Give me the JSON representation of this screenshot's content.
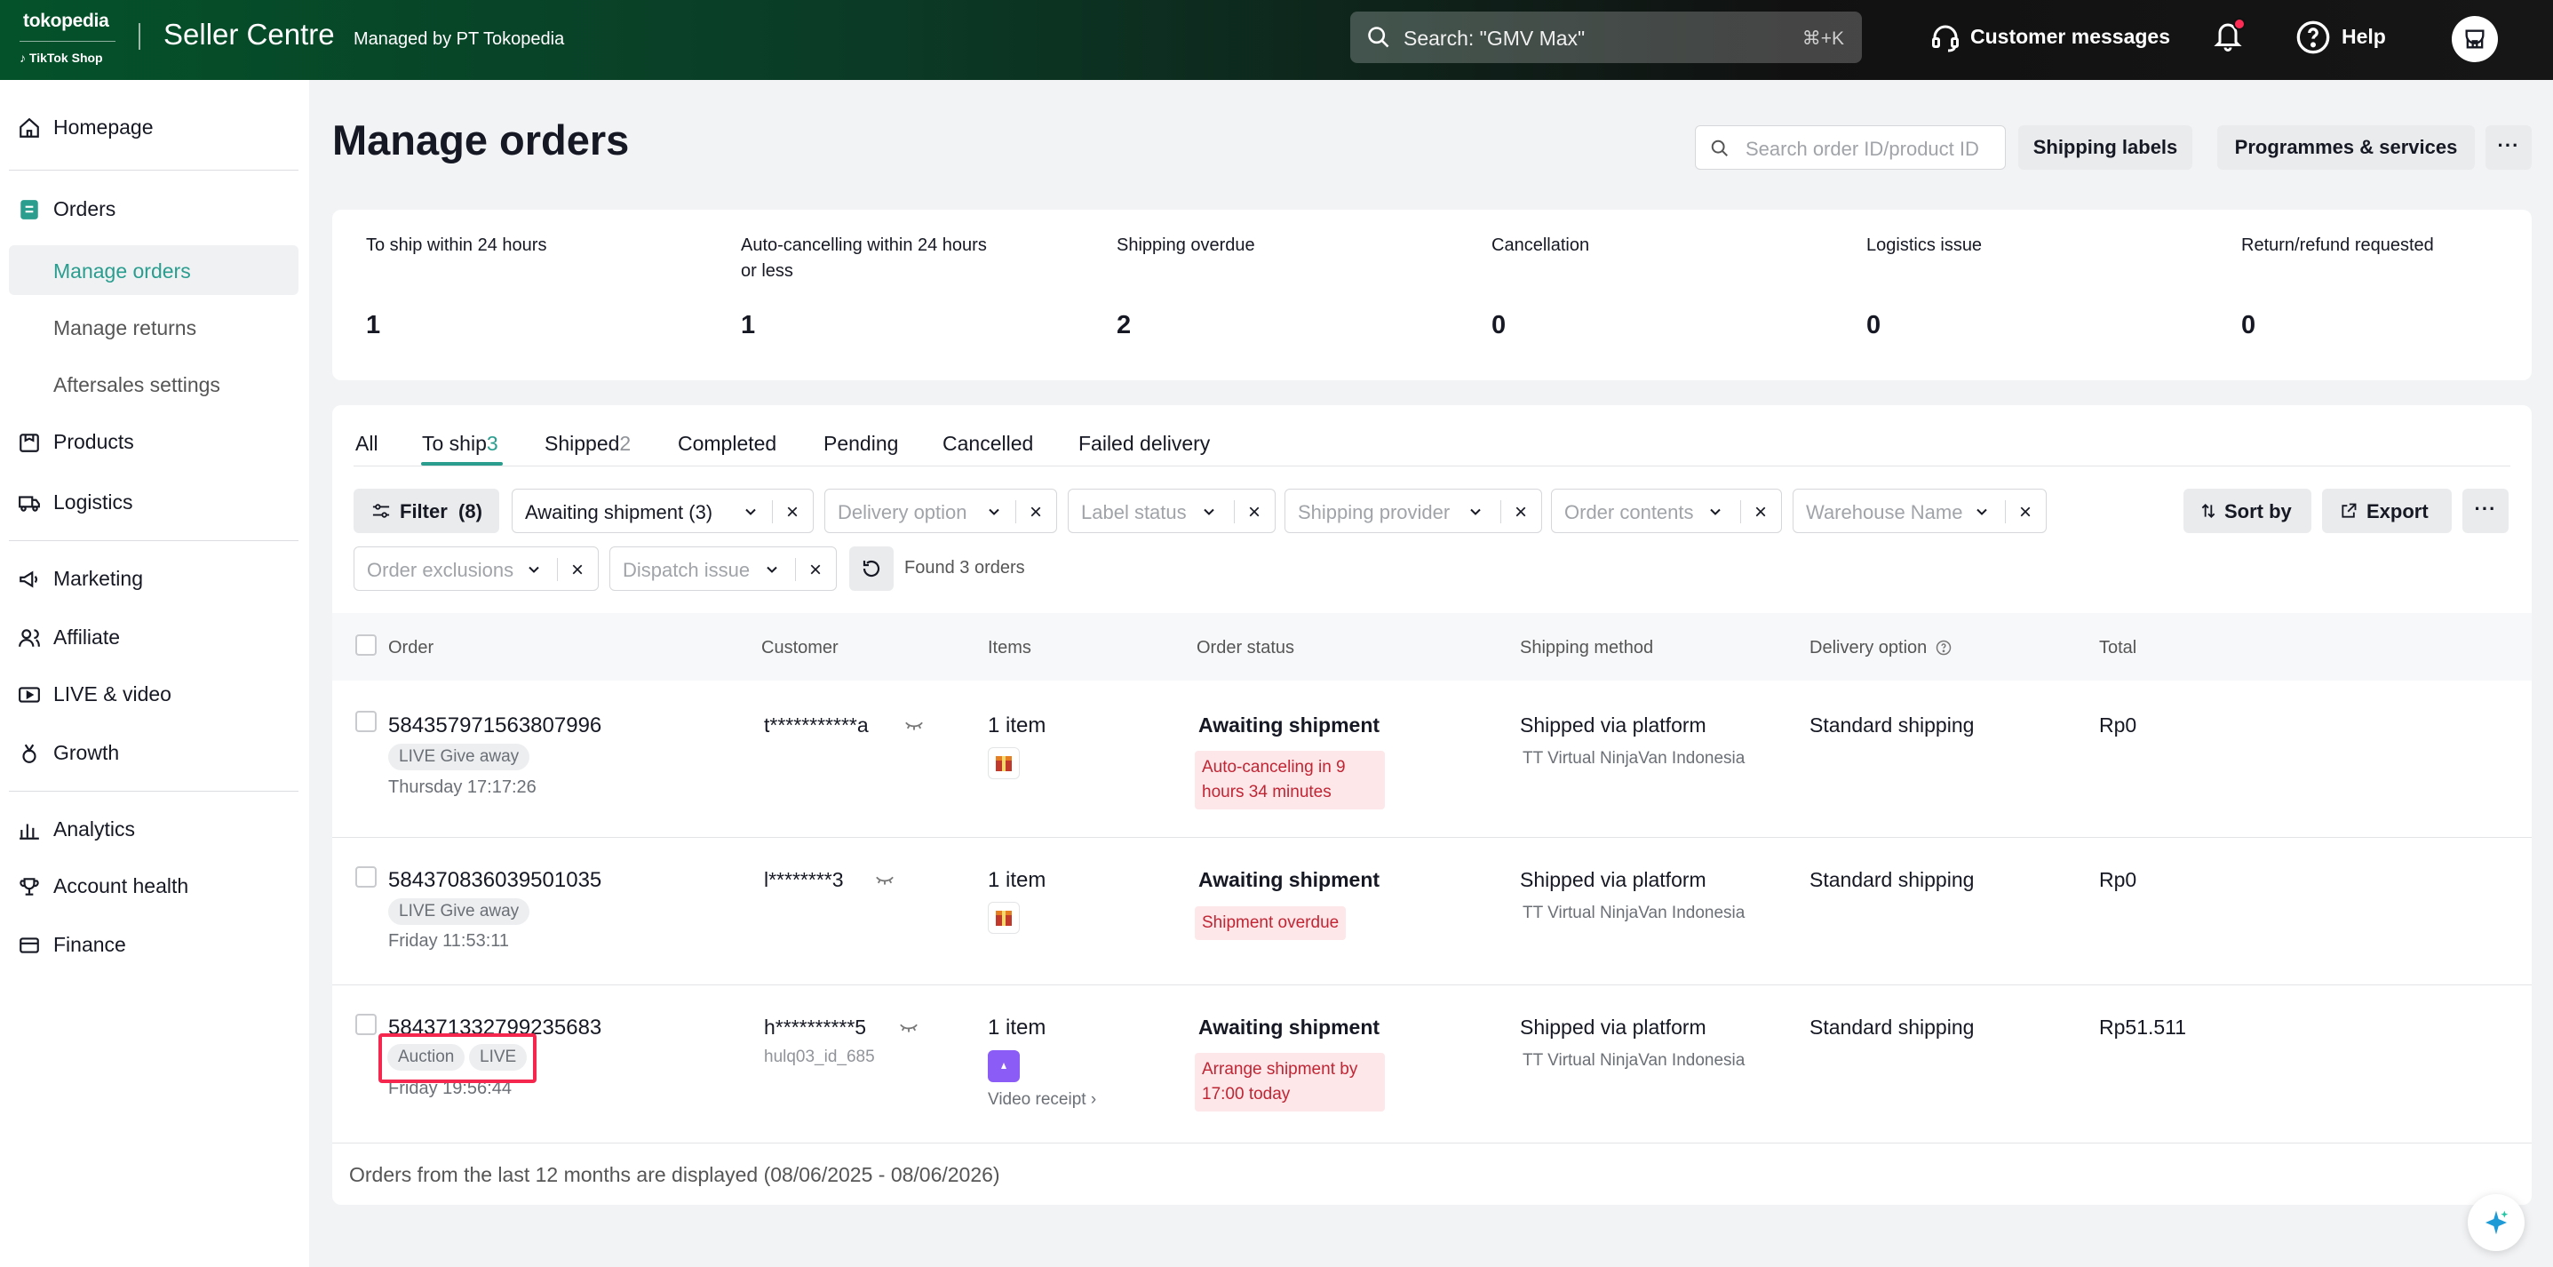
{
  "topbar": {
    "brand_top": "tokopedia",
    "brand_bottom": "TikTok Shop",
    "title": "Seller Centre",
    "managed_by": "Managed by PT Tokopedia",
    "search_placeholder": "Search: \"GMV Max\"",
    "search_shortcut": "⌘+K",
    "customer_messages": "Customer messages",
    "help": "Help"
  },
  "sidebar": {
    "items": [
      {
        "label": "Homepage",
        "icon": "home-icon"
      },
      {
        "label": "Orders",
        "icon": "orders-icon"
      },
      {
        "label": "Manage orders",
        "active": true
      },
      {
        "label": "Manage returns"
      },
      {
        "label": "Aftersales settings"
      },
      {
        "label": "Products",
        "icon": "products-icon"
      },
      {
        "label": "Logistics",
        "icon": "truck-icon"
      },
      {
        "label": "Marketing",
        "icon": "megaphone-icon"
      },
      {
        "label": "Affiliate",
        "icon": "affiliate-icon"
      },
      {
        "label": "LIVE & video",
        "icon": "video-icon"
      },
      {
        "label": "Growth",
        "icon": "medal-icon"
      },
      {
        "label": "Analytics",
        "icon": "analytics-icon"
      },
      {
        "label": "Account health",
        "icon": "trophy-icon"
      },
      {
        "label": "Finance",
        "icon": "wallet-icon"
      }
    ]
  },
  "header": {
    "title": "Manage orders",
    "search_placeholder": "Search order ID/product ID",
    "shipping_labels": "Shipping labels",
    "programmes": "Programmes & services"
  },
  "stats": [
    {
      "label": "To ship within 24 hours",
      "value": "1"
    },
    {
      "label": "Auto-cancelling within 24 hours or less",
      "value": "1"
    },
    {
      "label": "Shipping overdue",
      "value": "2"
    },
    {
      "label": "Cancellation",
      "value": "0"
    },
    {
      "label": "Logistics issue",
      "value": "0"
    },
    {
      "label": "Return/refund requested",
      "value": "0"
    }
  ],
  "tabs": [
    {
      "label": "All",
      "count": ""
    },
    {
      "label": "To ship",
      "count": "3"
    },
    {
      "label": "Shipped",
      "count": "2"
    },
    {
      "label": "Completed",
      "count": ""
    },
    {
      "label": "Pending",
      "count": ""
    },
    {
      "label": "Cancelled",
      "count": ""
    },
    {
      "label": "Failed delivery",
      "count": ""
    }
  ],
  "filters": {
    "filter_label": "Filter",
    "filter_count": "(8)",
    "chips": [
      "Awaiting shipment (3)",
      "Delivery option",
      "Label status",
      "Shipping provider",
      "Order contents",
      "Warehouse Name",
      "Order exclusions",
      "Dispatch issue"
    ],
    "found": "Found 3 orders",
    "sort_by": "Sort by",
    "export": "Export"
  },
  "table": {
    "headers": {
      "order": "Order",
      "customer": "Customer",
      "items": "Items",
      "status": "Order status",
      "shipping": "Shipping method",
      "delivery": "Delivery option",
      "total": "Total"
    },
    "rows": [
      {
        "order_id": "584357971563807996",
        "tags": [
          "LIVE Give away"
        ],
        "time": "Thursday 17:17:26",
        "customer": "t***********a",
        "customer_sub": "",
        "items": "1 item",
        "video_receipt": "",
        "status": "Awaiting shipment",
        "warning": "Auto-canceling in 9 hours 34 minutes",
        "shipping": "Shipped via platform",
        "shipping_sub": "TT Virtual NinjaVan Indonesia",
        "delivery": "Standard shipping",
        "total": "Rp0"
      },
      {
        "order_id": "584370836039501035",
        "tags": [
          "LIVE Give away"
        ],
        "time": "Friday 11:53:11",
        "customer": "l********3",
        "customer_sub": "",
        "items": "1 item",
        "video_receipt": "",
        "status": "Awaiting shipment",
        "warning": "Shipment overdue",
        "shipping": "Shipped via platform",
        "shipping_sub": "TT Virtual NinjaVan Indonesia",
        "delivery": "Standard shipping",
        "total": "Rp0"
      },
      {
        "order_id": "584371332799235683",
        "tags": [
          "Auction",
          "LIVE"
        ],
        "time": "Friday 19:56:44",
        "customer": "h**********5",
        "customer_sub": "hulq03_id_685",
        "items": "1 item",
        "video_receipt": "Video receipt ›",
        "status": "Awaiting shipment",
        "warning": "Arrange shipment by 17:00 today",
        "shipping": "Shipped via platform",
        "shipping_sub": "TT Virtual NinjaVan Indonesia",
        "delivery": "Standard shipping",
        "total": "Rp51.511"
      }
    ]
  },
  "footer_note": "Orders from the last 12 months are displayed (08/06/2025 - 08/06/2026)",
  "colors": {
    "accent": "#2a9d8f",
    "warning_bg": "#fde7e9",
    "warning_text": "#c02534",
    "highlight": "#f5274e"
  }
}
